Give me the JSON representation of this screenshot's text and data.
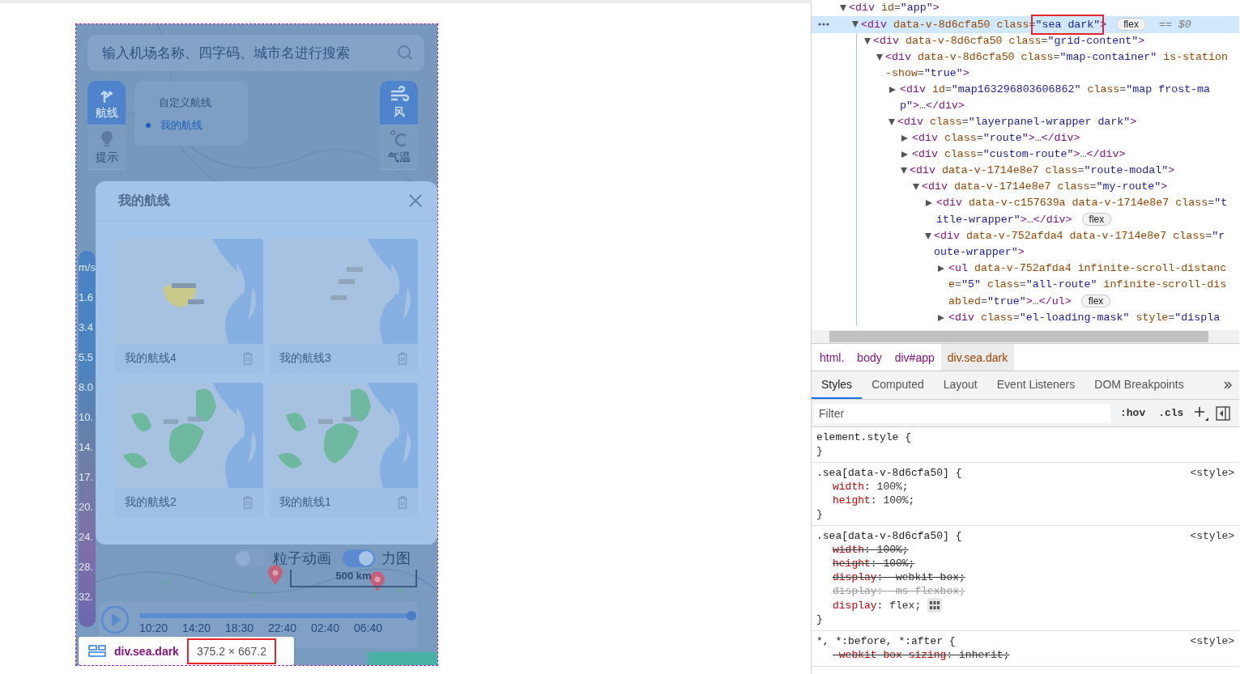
{
  "phone": {
    "search": {
      "placeholder": "输入机场名称、四字码、城市名进行搜索"
    },
    "left_tabs": [
      {
        "label": "航线",
        "selected": true
      },
      {
        "label": "提示",
        "selected": false
      }
    ],
    "custom_route": {
      "title": "自定义航线",
      "items": [
        {
          "label": "我的航线",
          "selected": true
        }
      ]
    },
    "right_tabs": [
      {
        "label": "风",
        "selected": true
      },
      {
        "label": "气温",
        "selected": false
      }
    ],
    "legend": {
      "unit": "m/s",
      "values": [
        "1.6",
        "3.4",
        "5.5",
        "8.0",
        "10.",
        "14.",
        "17.",
        "20.",
        "24.",
        "28.",
        "32."
      ]
    },
    "modal": {
      "title": "我的航线",
      "routes": [
        {
          "name": "我的航线4"
        },
        {
          "name": "我的航线3"
        },
        {
          "name": "我的航线2"
        },
        {
          "name": "我的航线1"
        }
      ]
    },
    "layers": [
      {
        "label": "粒子动画",
        "on": false
      },
      {
        "label": "力图",
        "on": true
      }
    ],
    "scale": "500 km",
    "timeline": {
      "level": 1,
      "times": [
        "10:20",
        "14:20",
        "18:30",
        "22:40",
        "02:40",
        "06:40"
      ]
    },
    "inspect_tooltip": {
      "selector": "div.sea.dark",
      "size": "375.2 × 667.2"
    }
  },
  "devtools": {
    "dom_tree": [
      {
        "text": "<div id=\"app\">",
        "expanded": true,
        "selected": false,
        "children": [
          {
            "text": "<div data-v-8d6cfa50 class=\"sea dark\">",
            "badge": "flex",
            "suffix": "== $0",
            "expanded": true,
            "selected": true,
            "children": [
              {
                "text": "<div data-v-8d6cfa50 class=\"grid-content\">",
                "expanded": true,
                "selected": false,
                "children": [
                  {
                    "text": "<div data-v-8d6cfa50 class=\"map-container\" is-station-show=\"true\">",
                    "expanded": true,
                    "selected": false,
                    "children": [
                      {
                        "text": "<div id=\"map163296803606862\" class=\"map frost-map\">…</div>",
                        "expanded": false,
                        "selected": false
                      },
                      {
                        "text": "<div class=\"layerpanel-wrapper dark\">",
                        "expanded": true,
                        "selected": false,
                        "children": [
                          {
                            "text": "<div class=\"route\">…</div>",
                            "expanded": false,
                            "selected": false
                          },
                          {
                            "text": "<div class=\"custom-route\">…</div>",
                            "expanded": false,
                            "selected": false
                          },
                          {
                            "text": "<div data-v-1714e8e7 class=\"route-modal\">",
                            "expanded": true,
                            "selected": false,
                            "children": [
                              {
                                "text": "<div data-v-1714e8e7 class=\"my-route\">",
                                "expanded": true,
                                "selected": false,
                                "children": [
                                  {
                                    "text": "<div data-v-c157639a data-v-1714e8e7 class=\"title-wrapper\">…</div>",
                                    "badge": "flex",
                                    "expanded": false,
                                    "selected": false
                                  },
                                  {
                                    "text": "<div data-v-752afda4 data-v-1714e8e7 class=\"route-wrapper\">",
                                    "expanded": true,
                                    "selected": false,
                                    "children": [
                                      {
                                        "text": "<ul data-v-752afda4 infinite-scroll-distance=\"5\" class=\"all-route\" infinite-scroll-disabled=\"true\">…</ul>",
                                        "badge": "flex",
                                        "expanded": false,
                                        "selected": false
                                      },
                                      {
                                        "text": "<div class=\"el-loading-mask\" style=\"displa",
                                        "expanded": false,
                                        "selected": false
                                      }
                                    ]
                                  }
                                ]
                              }
                            ]
                          }
                        ]
                      }
                    ]
                  }
                ]
              }
            ]
          }
        ]
      }
    ],
    "breadcrumbs": [
      {
        "label": "html.",
        "selected": false
      },
      {
        "label": "body",
        "selected": false
      },
      {
        "label": "div#app",
        "selected": false
      },
      {
        "label": "div.sea.dark",
        "selected": true
      }
    ],
    "tabs": [
      {
        "label": "Styles",
        "selected": true
      },
      {
        "label": "Computed",
        "selected": false
      },
      {
        "label": "Layout",
        "selected": false
      },
      {
        "label": "Event Listeners",
        "selected": false
      },
      {
        "label": "DOM Breakpoints",
        "selected": false
      }
    ],
    "filter": {
      "placeholder": "Filter"
    },
    "toggles": [
      ":hov",
      ".cls"
    ],
    "rules": [
      {
        "selector": "element.style {",
        "close": "}"
      },
      {
        "selector": ".sea[data-v-8d6cfa50] {",
        "source": "<style>",
        "close": "}",
        "declarations": [
          {
            "text": "width: 100%;",
            "overridden": false,
            "invalid": false
          },
          {
            "text": "height: 100%;",
            "overridden": false,
            "invalid": false
          }
        ]
      },
      {
        "selector": ".sea[data-v-8d6cfa50] {",
        "source": "<style>",
        "close": "}",
        "declarations": [
          {
            "text": "width: 100%;",
            "overridden": true,
            "invalid": false
          },
          {
            "text": "height: 100%;",
            "overridden": true,
            "invalid": false
          },
          {
            "text": "display: -webkit-box;",
            "overridden": true,
            "invalid": false
          },
          {
            "text": "display: -ms-flexbox;",
            "overridden": true,
            "invalid": true
          },
          {
            "text": "display: flex;",
            "overridden": false,
            "invalid": false,
            "editor": true
          }
        ]
      },
      {
        "selector": "*, *:before, *:after {",
        "source": "<style>",
        "declarations": [
          {
            "text": "-webkit-box-sizing: inherit;",
            "overridden": true,
            "invalid": false
          }
        ]
      }
    ]
  }
}
